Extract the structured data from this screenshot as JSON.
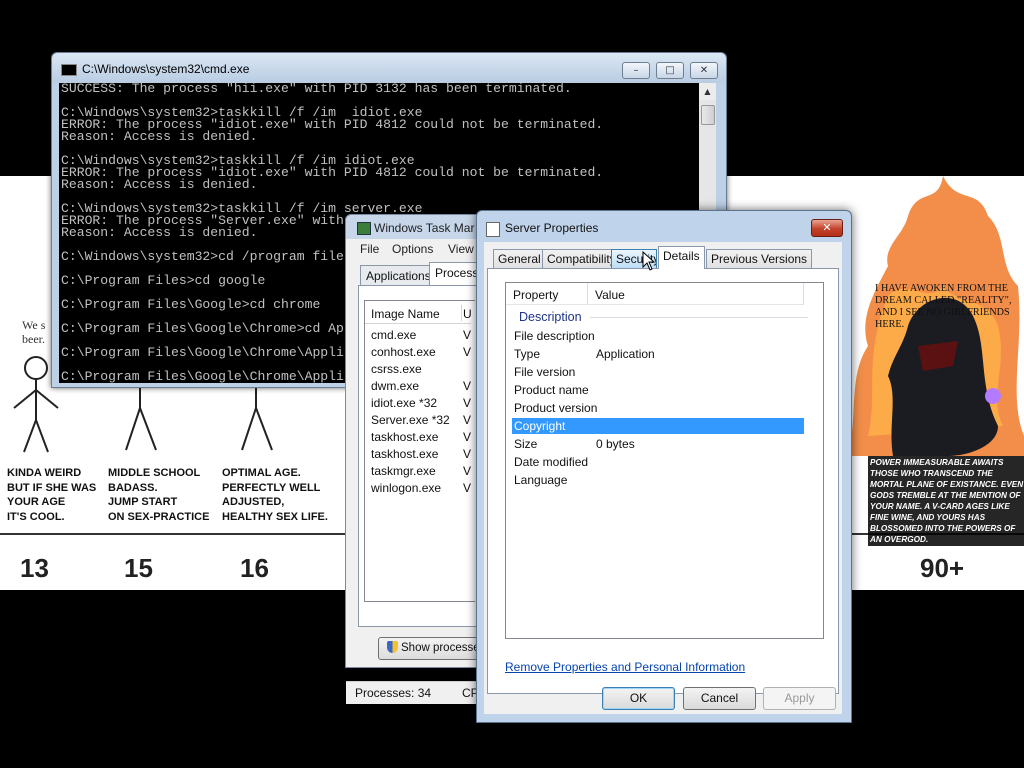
{
  "background": {
    "left_speech": "We s\nbeer.",
    "captions": [
      "KINDA WEIRD\nBUT IF SHE WAS\nYOUR AGE\nIT'S COOL.",
      "MIDDLE SCHOOL\nBADASS.\nJUMP START\nON SEX-PRACTICE",
      "OPTIMAL AGE.\nPERFECTLY WELL\nADJUSTED,\nHEALTHY SEX LIFE."
    ],
    "ages": [
      "13",
      "15",
      "16",
      "90+"
    ],
    "hero_quote": "I HAVE AWOKEN FROM THE DREAM CALLED \"REALITY\", AND I SEE NO GIRLFRIENDS HERE.",
    "power_text": "POWER IMMEASURABLE AWAITS THOSE WHO TRANSCEND THE MORTAL PLANE OF EXISTANCE. EVEN GODS TREMBLE AT THE MENTION OF YOUR NAME. A V-CARD AGES LIKE FINE WINE, AND YOURS HAS BLOSSOMED INTO THE POWERS OF AN OVERGOD."
  },
  "cmd": {
    "title": "C:\\Windows\\system32\\cmd.exe",
    "lines": [
      "SUCCESS: The process \"hii.exe\" with PID 3132 has been terminated.",
      "",
      "C:\\Windows\\system32>taskkill /f /im  idiot.exe",
      "ERROR: The process \"idiot.exe\" with PID 4812 could not be terminated.",
      "Reason: Access is denied.",
      "",
      "C:\\Windows\\system32>taskkill /f /im idiot.exe",
      "ERROR: The process \"idiot.exe\" with PID 4812 could not be terminated.",
      "Reason: Access is denied.",
      "",
      "C:\\Windows\\system32>taskkill /f /im server.exe",
      "ERROR: The process \"Server.exe\" with",
      "Reason: Access is denied.",
      "",
      "C:\\Windows\\system32>cd /program file",
      "",
      "C:\\Program Files>cd google",
      "",
      "C:\\Program Files\\Google>cd chrome",
      "",
      "C:\\Program Files\\Google\\Chrome>cd Ap",
      "",
      "C:\\Program Files\\Google\\Chrome\\Appli",
      "",
      "C:\\Program Files\\Google\\Chrome\\Appli"
    ]
  },
  "taskmgr": {
    "title": "Windows Task Mar",
    "menu": [
      "File",
      "Options",
      "View"
    ],
    "tabs": [
      "Applications",
      "Processes"
    ],
    "column": "Image Name",
    "column2": "U",
    "processes": [
      "cmd.exe",
      "conhost.exe",
      "csrss.exe",
      "dwm.exe",
      "idiot.exe *32",
      "Server.exe *32",
      "taskhost.exe",
      "taskhost.exe",
      "taskmgr.exe",
      "winlogon.exe"
    ],
    "user_col": [
      "V",
      "V",
      "",
      "V",
      "V",
      "V",
      "V",
      "V",
      "V",
      "V"
    ],
    "show_button": "Show processes",
    "status_processes": "Processes: 34",
    "status_cpu": "CP"
  },
  "dialog": {
    "title": "Server Properties",
    "tabs": [
      "General",
      "Compatibility",
      "Security",
      "Details",
      "Previous Versions"
    ],
    "selected_tab": "Details",
    "col_property": "Property",
    "col_value": "Value",
    "group": "Description",
    "rows": [
      {
        "k": "File description",
        "v": ""
      },
      {
        "k": "Type",
        "v": "Application"
      },
      {
        "k": "File version",
        "v": ""
      },
      {
        "k": "Product name",
        "v": ""
      },
      {
        "k": "Product version",
        "v": ""
      },
      {
        "k": "Copyright",
        "v": ""
      },
      {
        "k": "Size",
        "v": "0 bytes"
      },
      {
        "k": "Date modified",
        "v": ""
      },
      {
        "k": "Language",
        "v": ""
      }
    ],
    "selected_row": "Copyright",
    "link": "Remove Properties and Personal Information",
    "ok": "OK",
    "cancel": "Cancel",
    "apply": "Apply"
  },
  "colors": {
    "selection": "#3399ff",
    "link": "#0645ad",
    "close_button": "#c4422a"
  }
}
